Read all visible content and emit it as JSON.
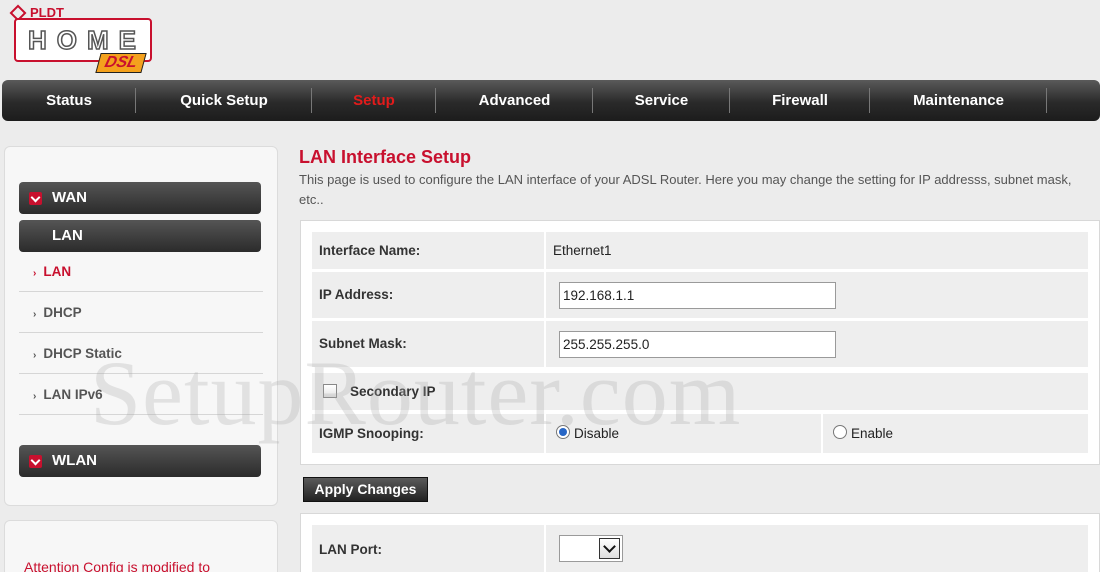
{
  "logo": {
    "brand": "PLDT",
    "product": "HOME",
    "badge": "DSL"
  },
  "nav": {
    "items": [
      {
        "label": "Status"
      },
      {
        "label": "Quick Setup"
      },
      {
        "label": "Setup"
      },
      {
        "label": "Advanced"
      },
      {
        "label": "Service"
      },
      {
        "label": "Firewall"
      },
      {
        "label": "Maintenance"
      }
    ],
    "active": "Setup",
    "active_color": "#e31b1b"
  },
  "sidebar": {
    "groups": {
      "wan": "WAN",
      "lan": "LAN",
      "wlan": "WLAN"
    },
    "lan_items": [
      {
        "label": "LAN"
      },
      {
        "label": "DHCP"
      },
      {
        "label": "DHCP Static"
      },
      {
        "label": "LAN IPv6"
      }
    ],
    "active_item": "LAN",
    "attention": "Attention Config is modified to"
  },
  "main": {
    "title": "LAN Interface Setup",
    "description": "This page is used to configure the LAN interface of your ADSL Router. Here you may change the setting for IP addresss, subnet mask, etc..",
    "interface_name_label": "Interface Name:",
    "interface_name_value": "Ethernet1",
    "ip_address_label": "IP Address:",
    "ip_address_value": "192.168.1.1",
    "subnet_mask_label": "Subnet Mask:",
    "subnet_mask_value": "255.255.255.0",
    "secondary_ip_label": "Secondary IP",
    "igmp_label": "IGMP Snooping:",
    "igmp_disable": "Disable",
    "igmp_enable": "Enable",
    "igmp_selected": "Disable",
    "apply_button": "Apply Changes",
    "lan_port_label": "LAN Port:",
    "lan_port_value": ""
  },
  "watermark": "SetupRouter.com",
  "colors": {
    "accent_red": "#c8102e",
    "nav_dark": "#2a2a2a",
    "radio_blue": "#2766c6"
  }
}
